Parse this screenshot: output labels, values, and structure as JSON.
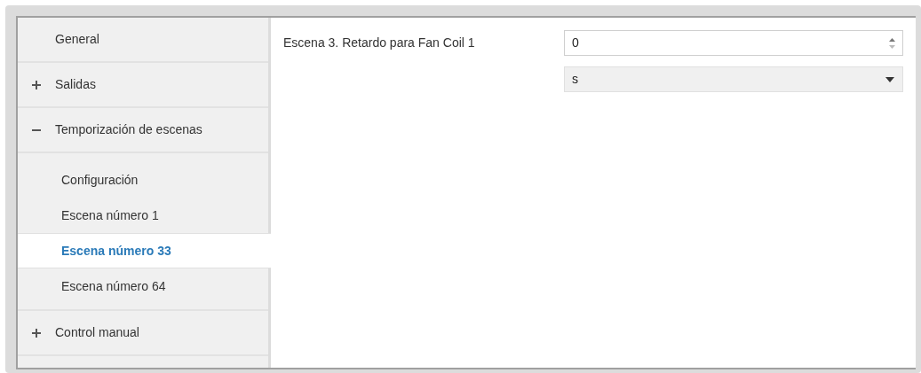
{
  "sidebar": {
    "items": [
      {
        "label": "General",
        "kind": "leaf",
        "selected": false
      },
      {
        "label": "Salidas",
        "kind": "group",
        "expanded": false,
        "selected": false
      },
      {
        "label": "Temporización de escenas",
        "kind": "group",
        "expanded": true,
        "selected": false,
        "children": [
          {
            "label": "Configuración",
            "selected": false
          },
          {
            "label": "Escena número 1",
            "selected": false
          },
          {
            "label": "Escena número 33",
            "selected": true
          },
          {
            "label": "Escena número 64",
            "selected": false
          }
        ]
      },
      {
        "label": "Control manual",
        "kind": "group",
        "expanded": false,
        "selected": false
      }
    ]
  },
  "parameters": [
    {
      "label": "Escena 3. Retardo para Fan Coil 1",
      "value": "0",
      "unit": "s"
    }
  ]
}
